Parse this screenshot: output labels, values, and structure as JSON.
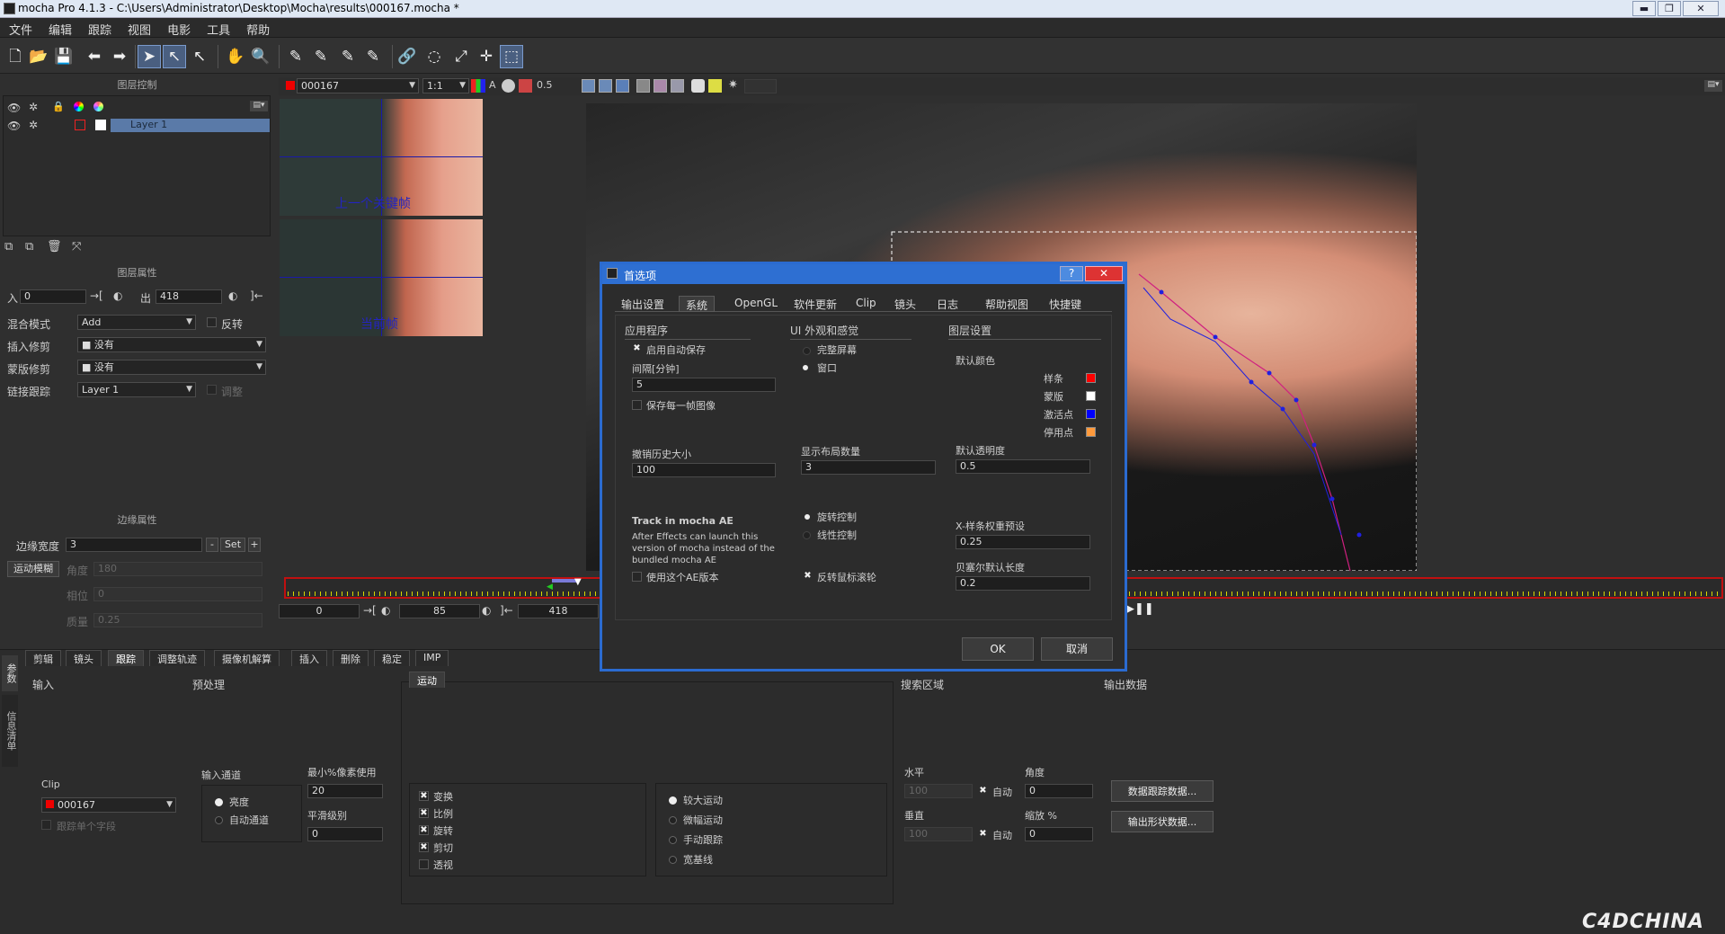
{
  "window": {
    "title": "mocha Pro 4.1.3 - C:\\Users\\Administrator\\Desktop\\Mocha\\results\\000167.mocha *",
    "min": "▬",
    "restore": "❐",
    "close": "✕"
  },
  "menu": [
    "文件",
    "编辑",
    "跟踪",
    "视图",
    "电影",
    "工具",
    "帮助"
  ],
  "layer_control": {
    "title": "图层控制",
    "layer_name": "Layer 1"
  },
  "viewer_bar": {
    "clip": "000167",
    "zoom": "1:1",
    "opacity_val": "0.5"
  },
  "thumbs": {
    "top_label": "上一个关键帧",
    "bottom_label": "当前帧"
  },
  "layer_props": {
    "title": "图层属性",
    "in_label": "入",
    "in_val": "0",
    "out_label": "出",
    "out_val": "418",
    "blend_label": "混合模式",
    "blend_val": "Add",
    "invert_label": "反转",
    "insert_clip_label": "插入修剪",
    "insert_clip_val": "没有",
    "matte_clip_label": "蒙版修剪",
    "matte_clip_val": "没有",
    "link_track_label": "链接跟踪",
    "link_track_val": "Layer 1",
    "adjust_label": "调整"
  },
  "edge_props": {
    "title": "边缘属性",
    "width_label": "边缘宽度",
    "width_val": "3",
    "minus": "-",
    "set": "Set",
    "plus": "+",
    "motion_blur": "运动模糊",
    "angle_label": "角度",
    "angle_val": "180",
    "phase_label": "相位",
    "phase_val": "0",
    "quality_label": "质量",
    "quality_val": "0.25"
  },
  "timeline": {
    "start": "0",
    "mid": "85",
    "end": "418"
  },
  "dialog": {
    "title": "首选项",
    "help_btn": "?",
    "close_btn": "✕",
    "tabs": [
      "输出设置",
      "系统",
      "OpenGL",
      "软件更新",
      "Clip",
      "镜头",
      "日志",
      "帮助视图",
      "快捷键"
    ],
    "app_section": "应用程序",
    "autosave": "启用自动保存",
    "interval_label": "间隔[分钟]",
    "interval_val": "5",
    "save_each_frame": "保存每一帧图像",
    "undo_label": "撤销历史大小",
    "undo_val": "100",
    "track_ae_title": "Track in mocha AE",
    "track_ae_desc": "After Effects can launch this version of mocha instead of the bundled mocha AE",
    "use_ae": "使用这个AE版本",
    "ui_section": "UI 外观和感觉",
    "fullscreen": "完整屏幕",
    "window": "窗口",
    "layout_count_label": "显示布局数量",
    "layout_count_val": "3",
    "rotate_ctrl": "旋转控制",
    "linear_ctrl": "线性控制",
    "invert_wheel": "反转鼠标滚轮",
    "layer_section": "图层设置",
    "default_color": "默认颜色",
    "spline": "样条",
    "matte": "蒙版",
    "active_pt": "激活点",
    "inactive_pt": "停用点",
    "spline_color": "#ff0000",
    "matte_color": "#ffffff",
    "active_color": "#0000ff",
    "inactive_color": "#ff9a3c",
    "default_opacity_label": "默认透明度",
    "default_opacity_val": "0.5",
    "xspline_label": "X-样条权重预设",
    "xspline_val": "0.25",
    "bezier_label": "贝塞尔默认长度",
    "bezier_val": "0.2",
    "ok": "OK",
    "cancel": "取消"
  },
  "bottom": {
    "side_tab1": "参数",
    "side_tab2": "信息清单",
    "tabs": [
      "剪辑",
      "镜头",
      "跟踪",
      "调整轨迹",
      "摄像机解算",
      "插入",
      "删除",
      "稳定",
      "IMP"
    ],
    "input_label": "输入",
    "preprocess_label": "预处理",
    "clip_label": "Clip",
    "clip_val": "000167",
    "track_single": "跟踪单个字段",
    "input_channel_label": "输入通道",
    "luminance": "亮度",
    "auto_channel": "自动通道",
    "min_pixel_label": "最小%像素使用",
    "min_pixel_val": "20",
    "smooth_label": "平滑级别",
    "smooth_val": "0",
    "motion_tab": "运动",
    "motion_opts": [
      "变换",
      "比例",
      "旋转",
      "剪切",
      "透视"
    ],
    "motion_types": [
      "较大运动",
      "微幅运动",
      "手动跟踪",
      "宽基线"
    ],
    "search_label": "搜索区域",
    "horizontal": "水平",
    "horizontal_val": "100",
    "vertical": "垂直",
    "vertical_val": "100",
    "auto": "自动",
    "angle": "角度",
    "angle_val": "0",
    "scale": "缩放 %",
    "scale_val": "0",
    "output_label": "输出数据",
    "export_track": "数据跟踪数据...",
    "export_shape": "输出形状数据..."
  },
  "watermark": "C4DCHINA"
}
